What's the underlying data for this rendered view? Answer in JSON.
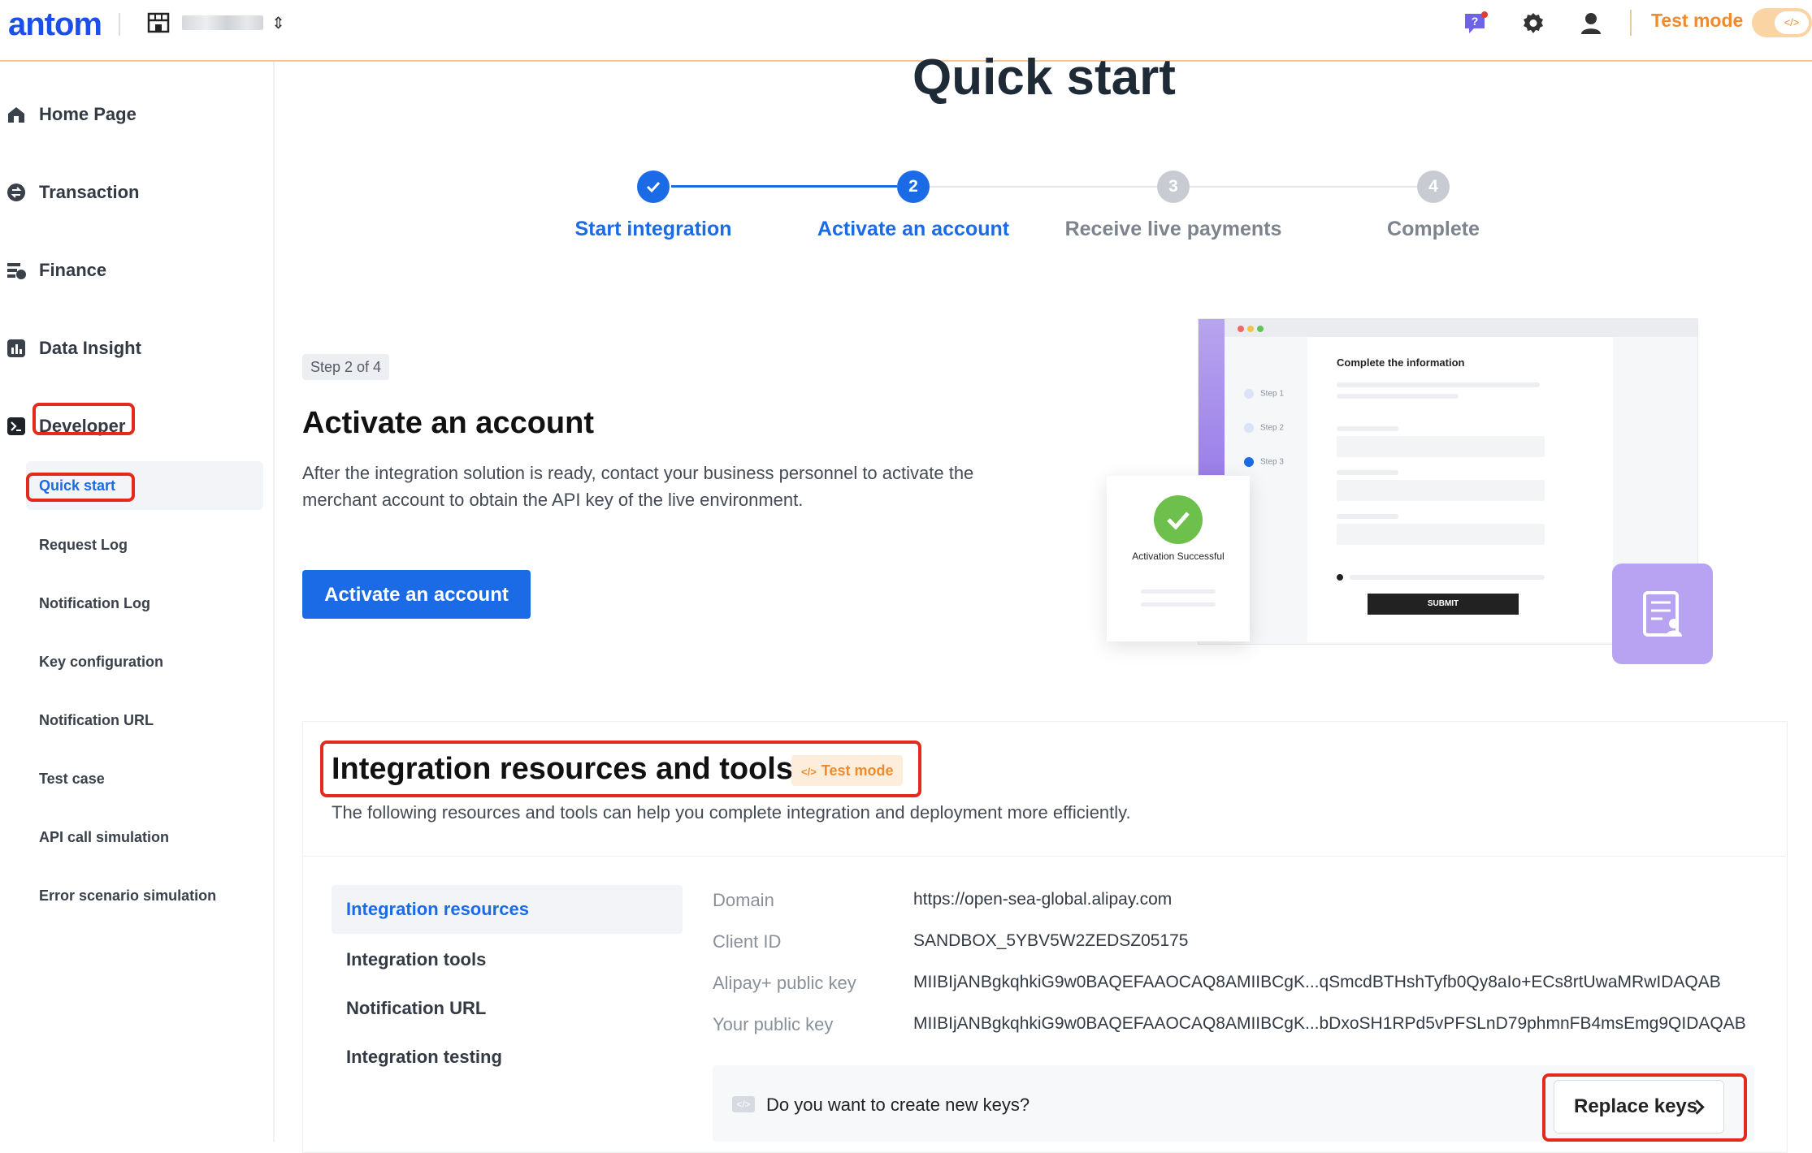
{
  "topbar": {
    "logo": "antom",
    "testmode_label": "Test mode",
    "toggle_glyph": "</>"
  },
  "sidebar": {
    "items": [
      {
        "label": "Home Page",
        "icon": "home-icon"
      },
      {
        "label": "Transaction",
        "icon": "transaction-icon"
      },
      {
        "label": "Finance",
        "icon": "finance-icon"
      },
      {
        "label": "Data Insight",
        "icon": "data-insight-icon"
      },
      {
        "label": "Developer",
        "icon": "developer-icon"
      }
    ],
    "developer_sub": [
      {
        "label": "Quick start"
      },
      {
        "label": "Request Log"
      },
      {
        "label": "Notification Log"
      },
      {
        "label": "Key configuration"
      },
      {
        "label": "Notification URL"
      },
      {
        "label": "Test case"
      },
      {
        "label": "API call simulation"
      },
      {
        "label": "Error scenario simulation"
      }
    ]
  },
  "main": {
    "title": "Quick start",
    "steps": [
      {
        "label": "Start integration",
        "number": "1",
        "state": "done"
      },
      {
        "label": "Activate an account",
        "number": "2",
        "state": "current"
      },
      {
        "label": "Receive live payments",
        "number": "3",
        "state": "pending"
      },
      {
        "label": "Complete",
        "number": "4",
        "state": "pending"
      }
    ],
    "step_tag": "Step 2 of 4",
    "section_title": "Activate an account",
    "section_desc": "After the integration solution is ready, contact your business personnel to activate the merchant account to obtain the API key of the live environment.",
    "activate_button": "Activate an account"
  },
  "illustration": {
    "form_title": "Complete the information",
    "steps": [
      "Step 1",
      "Step 2",
      "Step 3"
    ],
    "submit_label": "SUBMIT",
    "success_text": "Activation Successful"
  },
  "resources": {
    "title": "Integration resources and tools",
    "badge": "Test mode",
    "badge_glyph": "</>",
    "description": "The following resources and tools can help you complete integration and deployment more efficiently.",
    "tabs": [
      {
        "label": "Integration resources"
      },
      {
        "label": "Integration tools"
      },
      {
        "label": "Notification URL"
      },
      {
        "label": "Integration testing"
      }
    ],
    "fields": [
      {
        "key": "Domain",
        "value": "https://open-sea-global.alipay.com"
      },
      {
        "key": "Client ID",
        "value": "SANDBOX_5YBV5W2ZEDSZ05175"
      },
      {
        "key": "Alipay+ public key",
        "value": "MIIBIjANBgkqhkiG9w0BAQEFAAOCAQ8AMIIBCgK...qSmcdBTHshTyfb0Qy8aIo+ECs8rtUwaMRwIDAQAB"
      },
      {
        "key": "Your public key",
        "value": "MIIBIjANBgkqhkiG9w0BAQEFAAOCAQ8AMIIBCgK...bDxoSH1RPd5vPFSLnD79phmnFB4msEmg9QIDAQAB"
      }
    ],
    "keys_prompt": "Do you want to create new keys?",
    "keys_glyph": "</>",
    "replace_button": "Replace keys"
  },
  "colors": {
    "accent": "#1b6ae6",
    "test_mode": "#f08a2d",
    "annotation_red": "#e32a1c"
  }
}
